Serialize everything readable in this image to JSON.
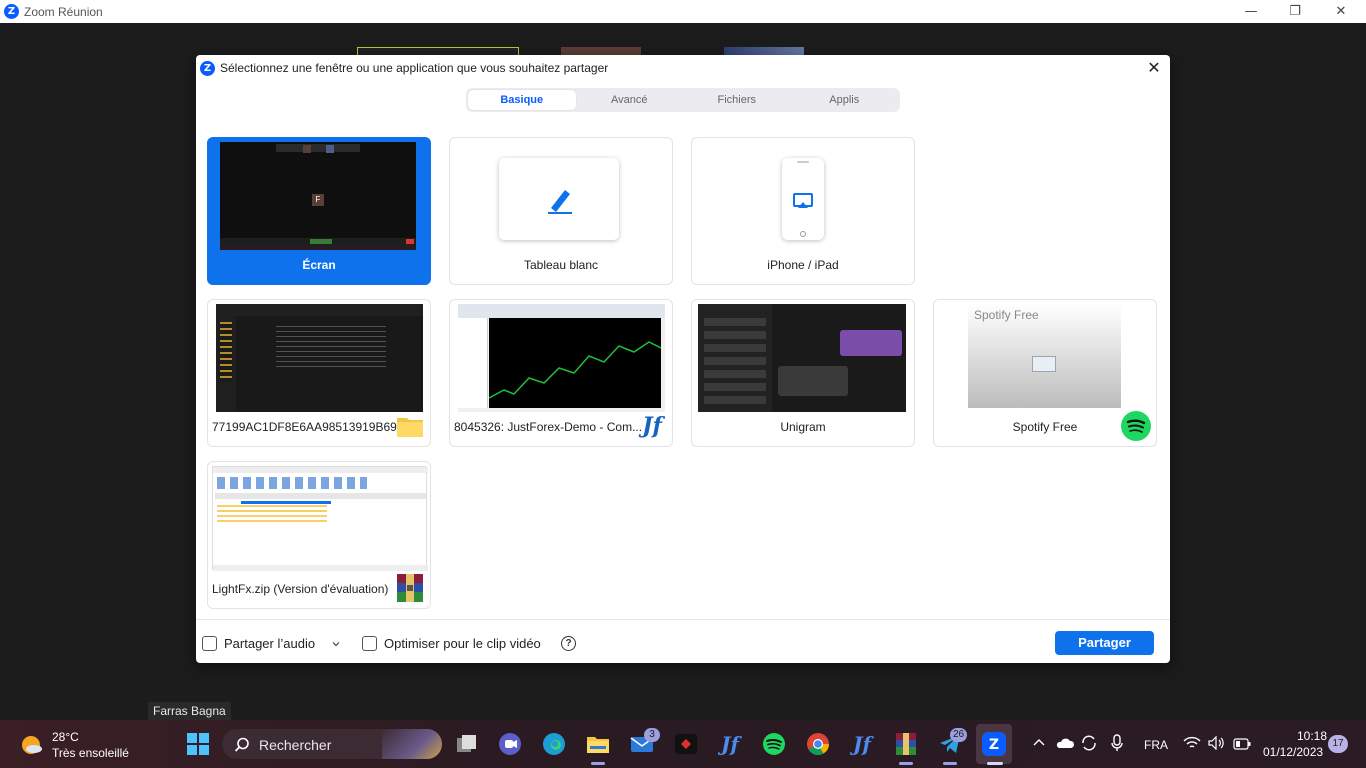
{
  "window": {
    "title": "Zoom Réunion",
    "min": "—",
    "max": "❐",
    "close": "✕"
  },
  "participant_name": "Farras Bagna",
  "dialog": {
    "title": "Sélectionnez une fenêtre ou une application que vous souhaitez partager",
    "close": "✕",
    "tabs": [
      "Basique",
      "Avancé",
      "Fichiers",
      "Applis"
    ],
    "active_tab": "Basique",
    "items": [
      {
        "label": "Écran",
        "selected": true
      },
      {
        "label": "Tableau blanc"
      },
      {
        "label": "iPhone / iPad"
      },
      {
        "label": "77199AC1DF8E6AA98513919B698..."
      },
      {
        "label": "8045326: JustForex-Demo - Com..."
      },
      {
        "label": "Unigram"
      },
      {
        "label": "Spotify Free",
        "preview_text": "Spotify Free"
      },
      {
        "label": "LightFx.zip (Version d'évaluation)"
      }
    ],
    "screen_preview_letter": "F",
    "share_audio_label": "Partager l’audio",
    "optimize_label": "Optimiser pour le clip vidéo",
    "help_icon": "?",
    "share_button": "Partager"
  },
  "taskbar": {
    "weather_temp": "28°C",
    "weather_desc": "Très ensoleillé",
    "search_placeholder": "Rechercher",
    "mail_badge": "3",
    "telegram_badge": "26",
    "language": "FRA",
    "time": "10:18",
    "date": "01/12/2023",
    "notifications": "17"
  },
  "colors": {
    "accent": "#0e72ed",
    "zoom_blue": "#0b5cff",
    "spotify_green": "#1ed760"
  }
}
